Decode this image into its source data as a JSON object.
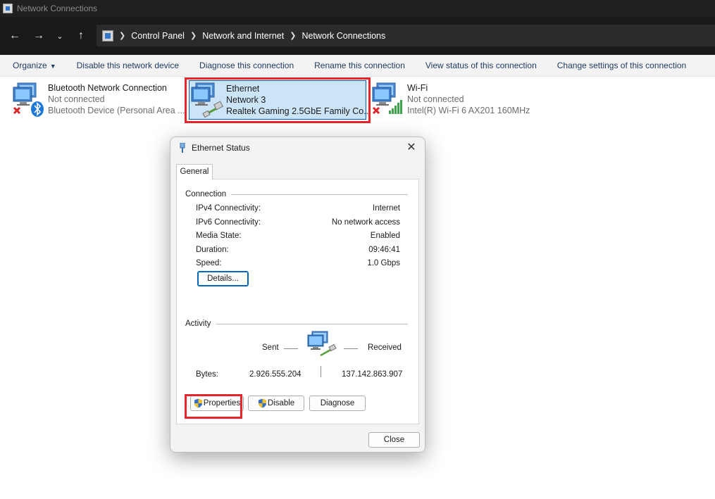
{
  "window": {
    "title": "Network Connections"
  },
  "address_bar": {
    "breadcrumbs": [
      "Control Panel",
      "Network and Internet",
      "Network Connections"
    ]
  },
  "command_bar": {
    "items": [
      "Organize",
      "Disable this network device",
      "Diagnose this connection",
      "Rename this connection",
      "View status of this connection",
      "Change settings of this connection"
    ]
  },
  "connections": [
    {
      "name": "Bluetooth Network Connection",
      "status": "Not connected",
      "device": "Bluetooth Device (Personal Area ..."
    },
    {
      "name": "Ethernet",
      "status": "Network 3",
      "device": "Realtek Gaming 2.5GbE Family Co..."
    },
    {
      "name": "Wi-Fi",
      "status": "Not connected",
      "device": "Intel(R) Wi-Fi 6 AX201 160MHz"
    }
  ],
  "dialog": {
    "title": "Ethernet Status",
    "tab": "General",
    "connection": {
      "label": "Connection",
      "rows": [
        {
          "label": "IPv4 Connectivity:",
          "value": "Internet"
        },
        {
          "label": "IPv6 Connectivity:",
          "value": "No network access"
        },
        {
          "label": "Media State:",
          "value": "Enabled"
        },
        {
          "label": "Duration:",
          "value": "09:46:41"
        },
        {
          "label": "Speed:",
          "value": "1.0 Gbps"
        }
      ],
      "details_button": "Details..."
    },
    "activity": {
      "label": "Activity",
      "sent_label": "Sent",
      "received_label": "Received",
      "bytes_label": "Bytes:",
      "bytes_sent": "2.926.555.204",
      "bytes_received": "137.142.863.907"
    },
    "buttons": {
      "properties": "Properties",
      "disable": "Disable",
      "diagnose": "Diagnose",
      "close": "Close"
    }
  },
  "colors": {
    "highlight_red": "#e5242b",
    "selection_blue": "#cce4f7",
    "link_blue": "#1f3b63"
  }
}
